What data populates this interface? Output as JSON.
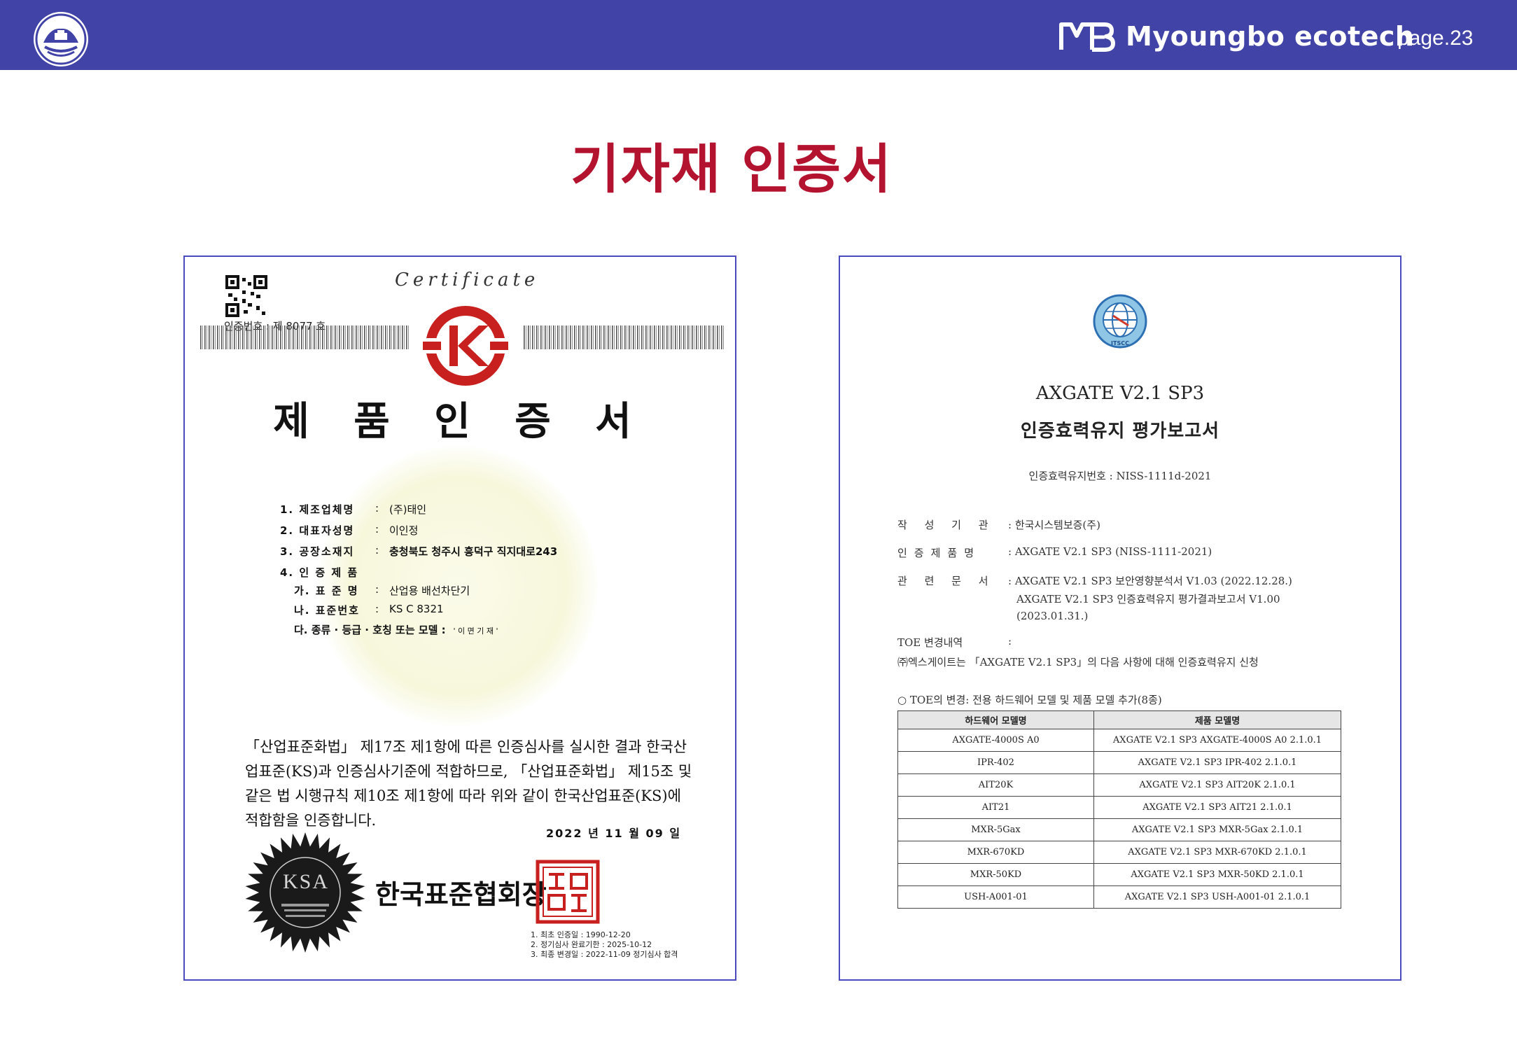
{
  "header": {
    "brand_name": "Myoungbo ecotech",
    "page_label": "page.23",
    "bar_color": "#4143a6"
  },
  "title": "기자재 인증서",
  "title_color": "#b3132e",
  "certificate_left": {
    "script_word": "Certificate",
    "cert_number": "인증번호 : 제 8077 호",
    "main_title": "제 품 인 증 서",
    "fields": [
      {
        "label": "1.  제조업체명",
        "value": "(주)태인"
      },
      {
        "label": "2.  대표자성명",
        "value": "이인정"
      },
      {
        "label": "3.  공장소재지",
        "value": "충청북도 청주시 흥덕구 직지대로243"
      },
      {
        "label": "4.  인 증 제 품",
        "value": ""
      },
      {
        "label": "가. 표 준 명",
        "value": "산업용 배선차단기"
      },
      {
        "label": "나. 표준번호",
        "value": "KS C 8321"
      },
      {
        "label": "다. 종류 · 등급 · 호칭 또는 모델 :",
        "value": "' 이 면 기 재 '"
      }
    ],
    "body_text": "「산업표준화법」 제17조 제1항에 따른 인증심사를 실시한 결과 한국산업표준(KS)과 인증심사기준에 적합하므로, 「산업표준화법」 제15조 및 같은 법 시행규칙 제10조 제1항에 따라 위와 같이 한국산업표준(KS)에 적합함을 인증합니다.",
    "date": "2022 년  11  월  09  일",
    "seal_text": "KSA",
    "issuer": "한국표준협회장",
    "footnotes": [
      "1. 최초 인증일 : 1990-12-20",
      "2. 정기심사 완료기한 : 2025-10-12",
      "3. 최종 변경일 : 2022-11-09 정기심사 합격"
    ],
    "ks_color": "#c8201e"
  },
  "report_right": {
    "logo_label": "ITSCC",
    "title": "AXGATE V2.1 SP3",
    "subtitle": "인증효력유지 평가보고서",
    "report_no": "인증효력유지번호 : NISS-1111d-2021",
    "rows": [
      {
        "label": "작 성 기 관",
        "value": ": 한국시스템보증(주)"
      },
      {
        "label": "인증제품명",
        "value": ": AXGATE V2.1 SP3 (NISS-1111-2021)"
      },
      {
        "label": "관 련 문 서",
        "value": ": AXGATE V2.1 SP3 보안영향분석서 V1.03 (2022.12.28.)"
      }
    ],
    "related_doc_line2": "AXGATE V2.1 SP3 인증효력유지 평가결과보고서 V1.00",
    "related_doc_line3": "(2023.01.31.)",
    "toe_label": "TOE  변경내역",
    "toe_colon": ":",
    "toe_desc": "㈜엑스게이트는 「AXGATE V2.1 SP3」의 다음 사항에 대해 인증효력유지 신청",
    "change_note": "○ TOE의 변경: 전용 하드웨어 모델 및 제품 모델 추가(8종)",
    "table": {
      "headers": [
        "하드웨어 모델명",
        "제품 모델명"
      ],
      "rows": [
        [
          "AXGATE-4000S A0",
          "AXGATE V2.1 SP3 AXGATE-4000S A0 2.1.0.1"
        ],
        [
          "IPR-402",
          "AXGATE V2.1 SP3 IPR-402 2.1.0.1"
        ],
        [
          "AIT20K",
          "AXGATE V2.1 SP3 AIT20K 2.1.0.1"
        ],
        [
          "AIT21",
          "AXGATE V2.1 SP3 AIT21 2.1.0.1"
        ],
        [
          "MXR-5Gax",
          "AXGATE V2.1 SP3 MXR-5Gax 2.1.0.1"
        ],
        [
          "MXR-670KD",
          "AXGATE V2.1 SP3 MXR-670KD 2.1.0.1"
        ],
        [
          "MXR-50KD",
          "AXGATE V2.1 SP3 MXR-50KD 2.1.0.1"
        ],
        [
          "USH-A001-01",
          "AXGATE V2.1 SP3 USH-A001-01 2.1.0.1"
        ]
      ]
    }
  }
}
